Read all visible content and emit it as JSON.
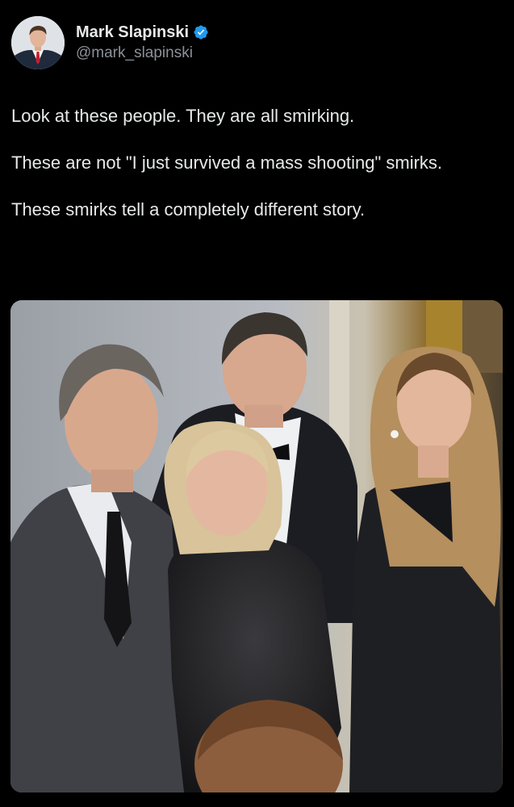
{
  "author": {
    "display_name": "Mark Slapinski",
    "handle": "@mark_slapinski",
    "verified": true,
    "verified_color": "#1d9bf0"
  },
  "post": {
    "paragraphs": [
      "Look at these people. They are all smirking.",
      "These are not \"I just survived a mass shooting\" smirks.",
      "These smirks tell a completely different story."
    ]
  },
  "media": {
    "type": "photo",
    "subject": "four people in formal attire standing in a hallway"
  },
  "colors": {
    "background": "#000000",
    "text_primary": "#e7e9ea",
    "text_secondary": "#8b9197"
  }
}
